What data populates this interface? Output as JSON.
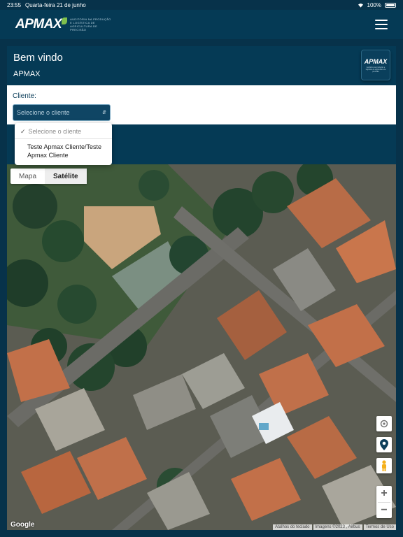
{
  "status_bar": {
    "time": "23:55",
    "date": "Quarta-feira 21 de junho",
    "battery": "100%"
  },
  "header": {
    "logo": "APMAX",
    "logo_tagline": "Auditoria na produção e logística de agricultura de precisão"
  },
  "welcome_card": {
    "title": "Bem vindo",
    "organization": "APMAX",
    "badge_logo": "APMAX"
  },
  "client_filter": {
    "label": "Cliente:",
    "selected": "Selecione o cliente",
    "options": [
      {
        "label": "Selecione o cliente",
        "checked": true
      },
      {
        "label": "Teste Apmax Cliente/Teste Apmax Cliente",
        "checked": false
      }
    ]
  },
  "map": {
    "type_buttons": {
      "map": "Mapa",
      "satellite": "Satélite"
    },
    "active_type": "Satélite",
    "provider": "Google",
    "attribution": {
      "shortcuts": "Atalhos do teclado",
      "imagery": "Imagens ©2023 , Airbus",
      "terms": "Termos de Uso"
    },
    "controls": [
      "settings-icon",
      "location-pin-icon",
      "pegman-icon",
      "zoom-in-icon",
      "zoom-out-icon"
    ]
  },
  "colors": {
    "brand_dark": "#053a55",
    "brand_mid": "#0f4564",
    "background": "#07324a"
  }
}
